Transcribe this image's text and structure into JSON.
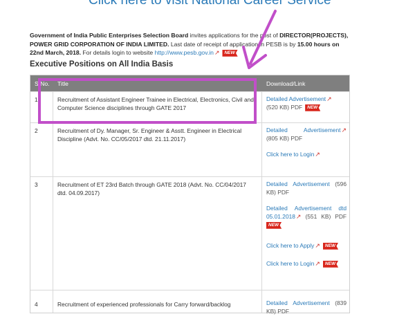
{
  "top_link": {
    "text": "Click here to visit National Career Service"
  },
  "intro": {
    "p1": "Government of India Public Enterprises Selection Board",
    "p2": " invites applications for the post of ",
    "post": "DIRECTOR(PROJECTS), POWER GRID CORPORATION OF INDIA LIMITED.",
    "p3": " Last date of receipt of application in PESB is by ",
    "deadline": "15.00 hours on 22nd March, 2018.",
    "p4": " For details login to website ",
    "website": "http://www.pesb.gov.in"
  },
  "badge_new": "NEW",
  "section_title": "Executive Positions on All India Basis",
  "table": {
    "headers": {
      "sno": "S.No.",
      "title": "Title",
      "download": "Download/Link"
    },
    "rows": [
      {
        "no": "1",
        "title": "Recruitment of Assistant Engineer Trainee in Electrical, Electronics, Civil and Computer Science disciplines through GATE 2017",
        "dl_adv": "Detailed Advertisement",
        "dl_size": "(520 KB) PDF"
      },
      {
        "no": "2",
        "title": "Recruitment of Dy. Manager, Sr. Engineer & Asstt. Engineer in Electrical Discipline (Advt. No. CC/05/2017 dtd. 21.11.2017)",
        "dl_adv_a": "Detailed",
        "dl_adv_b": "Advertisement",
        "dl_size": "(805 KB) PDF",
        "login": "Click here to Login"
      },
      {
        "no": "3",
        "title": "Recruitment of ET 23rd Batch through GATE 2018 (Advt. No. CC/04/2017 dtd. 04.09.2017)",
        "dl_w1": "Detailed",
        "dl_w2": "Advertisement",
        "dl_w3": "(596",
        "dl_size": "KB) PDF",
        "dl2_w1": "Detailed",
        "dl2_w2": "Advertisement",
        "dl2_w3": "dtd",
        "dl2_date": "05.01.2018",
        "dl2_size1": "(551",
        "dl2_size2": "KB)",
        "dl2_size3": "PDF",
        "apply": "Click here to Apply",
        "login": "Click here to Login"
      },
      {
        "no": "4",
        "title": "Recruitment of experienced professionals for Carry forward/backlog",
        "dl_w1": "Detailed",
        "dl_w2": "Advertisement",
        "dl_w3": "(839",
        "dl_size": "KB) PDF"
      }
    ]
  },
  "colors": {
    "link": "#2a7ab8",
    "badge": "#d8261c",
    "highlight": "#c14fc9",
    "header_bg": "#7f7f7f"
  }
}
